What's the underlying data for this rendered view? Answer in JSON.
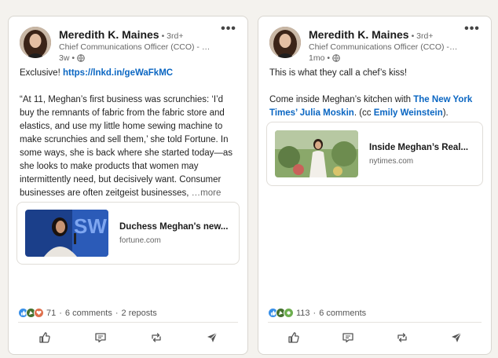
{
  "posts": [
    {
      "author": {
        "name": "Meredith K. Maines",
        "degree": "• 3rd+",
        "headline": "Chief Communications Officer (CCO) - Off...",
        "time": "3w •"
      },
      "body": {
        "line1_prefix": "Exclusive! ",
        "line1_link": "https://lnkd.in/geWaFkMC",
        "quote": "“At 11, Meghan’s first business was scrunchies: ‘I’d buy the remnants of fabric from the fabric store and elastics, and use my little home sewing machine to make scrunchies and sell them,’ she told Fortune. In some ways, she is back where she started today—as she looks to make products that women may intermittently need, but decisively want. Consumer businesses are often zeitgeist businesses,",
        "see_more": " …more"
      },
      "link_preview": {
        "title": "Duchess Meghan's new...",
        "domain": "fortune.com"
      },
      "social": {
        "reaction_count": "71",
        "comments": "6 comments",
        "reposts": "2 reposts"
      }
    },
    {
      "author": {
        "name": "Meredith K. Maines",
        "degree": "• 3rd+",
        "headline": "Chief Communications Officer (CCO) - Off...",
        "time": "1mo •"
      },
      "body": {
        "line1": "This is what they call a chef’s kiss!",
        "p2_prefix": "Come inside Meghan’s kitchen with ",
        "p2_link1": "The New York Times’ Julia Moskin",
        "p2_mid": ". (cc ",
        "p2_link2": "Emily Weinstein",
        "p2_suffix": ")."
      },
      "link_preview": {
        "title": "Inside Meghan’s Real...",
        "domain": "nytimes.com"
      },
      "social": {
        "reaction_count": "113",
        "comments": "6 comments"
      }
    }
  ],
  "actions": [
    "like-icon",
    "comment-icon",
    "repost-icon",
    "send-icon"
  ],
  "colors": {
    "link": "#0a66c2",
    "like_reaction": "#378fe9",
    "celebrate_reaction": "#44712e",
    "love_reaction": "#df704d"
  }
}
